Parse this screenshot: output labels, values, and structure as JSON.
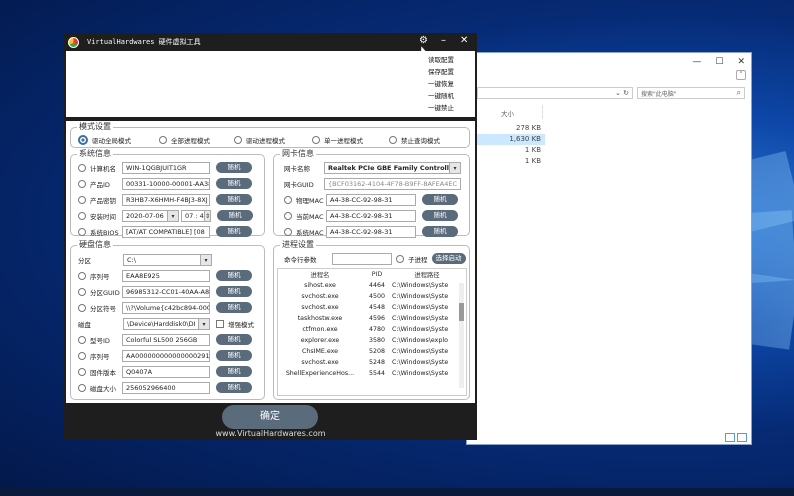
{
  "app": {
    "title": "VirtualHardwares 硬件虚拟工具",
    "footer": "www.VirtualHardwares.com",
    "confirm_label": "确定",
    "menu_items": [
      "读取配置",
      "保存配置",
      "一键恢复",
      "一键随机",
      "一键禁止"
    ]
  },
  "mode": {
    "title": "模式设置",
    "options": [
      {
        "label": "驱动全局模式",
        "selected": true
      },
      {
        "label": "全部进程模式",
        "selected": false
      },
      {
        "label": "驱动进程模式",
        "selected": false
      },
      {
        "label": "单一进程模式",
        "selected": false
      },
      {
        "label": "禁止查询模式",
        "selected": false
      }
    ]
  },
  "system": {
    "title": "系统信息",
    "random_label": "随机",
    "rows": [
      {
        "label": "计算机名",
        "value": "WIN-1QGBJUIT1GR"
      },
      {
        "label": "产品ID",
        "value": "00331-10000-00001-AA380"
      },
      {
        "label": "产品密钥",
        "value": "R3HB7-X6HMH-F4BJ3-8XJ"
      },
      {
        "label": "安装时间",
        "date": "2020-07-06",
        "time": "07 : 40"
      },
      {
        "label": "系统BIOS",
        "value": "[AT/AT COMPATIBLE] [08"
      }
    ]
  },
  "nic": {
    "title": "网卡信息",
    "random_label": "随机",
    "name_label": "网卡名称",
    "name_value": "Realtek PCIe GBE Family Controll",
    "guid_label": "网卡GUID",
    "guid_value": "{BCF03162-4104-4F78-B9FF-8AFEA4EC",
    "rows": [
      {
        "label": "物理MAC",
        "value": "A4-38-CC-92-98-31"
      },
      {
        "label": "当前MAC",
        "value": "A4-38-CC-92-98-31"
      },
      {
        "label": "系统MAC",
        "value": "A4-38-CC-92-98-31"
      }
    ]
  },
  "disk": {
    "title": "硬盘信息",
    "random_label": "随机",
    "partition_label": "分区",
    "partition_value": "C:\\",
    "rows": [
      {
        "label": "序列号",
        "value": "EAA8E925"
      },
      {
        "label": "分区GUID",
        "value": "96985312-CC01-40AA-A83"
      },
      {
        "label": "分区符号",
        "value": "\\\\?\\Volume{c42bc894-000"
      }
    ],
    "disk_label": "磁盘",
    "disk_value": "\\Device\\Harddisk0\\DI",
    "enhanced_label": "增强模式",
    "rows2": [
      {
        "label": "型号ID",
        "value": "Colorful SL500 256GB"
      },
      {
        "label": "序列号",
        "value": "AA000000000000000291"
      },
      {
        "label": "固件版本",
        "value": "Q0407A"
      },
      {
        "label": "磁盘大小",
        "value": "256052966400"
      }
    ]
  },
  "process": {
    "title": "进程设置",
    "cmd_label": "命令行参数",
    "child_label": "子进程",
    "select_label": "选择启动",
    "headers": [
      "进程名",
      "PID",
      "进程路径"
    ],
    "rows": [
      {
        "name": "sihost.exe",
        "pid": "4464",
        "path": "C:\\Windows\\Syste"
      },
      {
        "name": "svchost.exe",
        "pid": "4500",
        "path": "C:\\Windows\\Syste"
      },
      {
        "name": "svchost.exe",
        "pid": "4548",
        "path": "C:\\Windows\\Syste"
      },
      {
        "name": "taskhostw.exe",
        "pid": "4596",
        "path": "C:\\Windows\\Syste"
      },
      {
        "name": "ctfmon.exe",
        "pid": "4780",
        "path": "C:\\Windows\\Syste"
      },
      {
        "name": "explorer.exe",
        "pid": "3580",
        "path": "C:\\Windows\\explo"
      },
      {
        "name": "ChsIME.exe",
        "pid": "5208",
        "path": "C:\\Windows\\Syste"
      },
      {
        "name": "svchost.exe",
        "pid": "5248",
        "path": "C:\\Windows\\Syste"
      },
      {
        "name": "ShellExperienceHos...",
        "pid": "5544",
        "path": "C:\\Windows\\Syste"
      }
    ]
  },
  "explorer": {
    "search_placeholder": "搜索\"此电脑\"",
    "size_header": "大小",
    "sizes": [
      "278 KB",
      "1,630 KB",
      "1 KB",
      "1 KB"
    ],
    "min": "—",
    "max": "☐",
    "close": "✕"
  }
}
